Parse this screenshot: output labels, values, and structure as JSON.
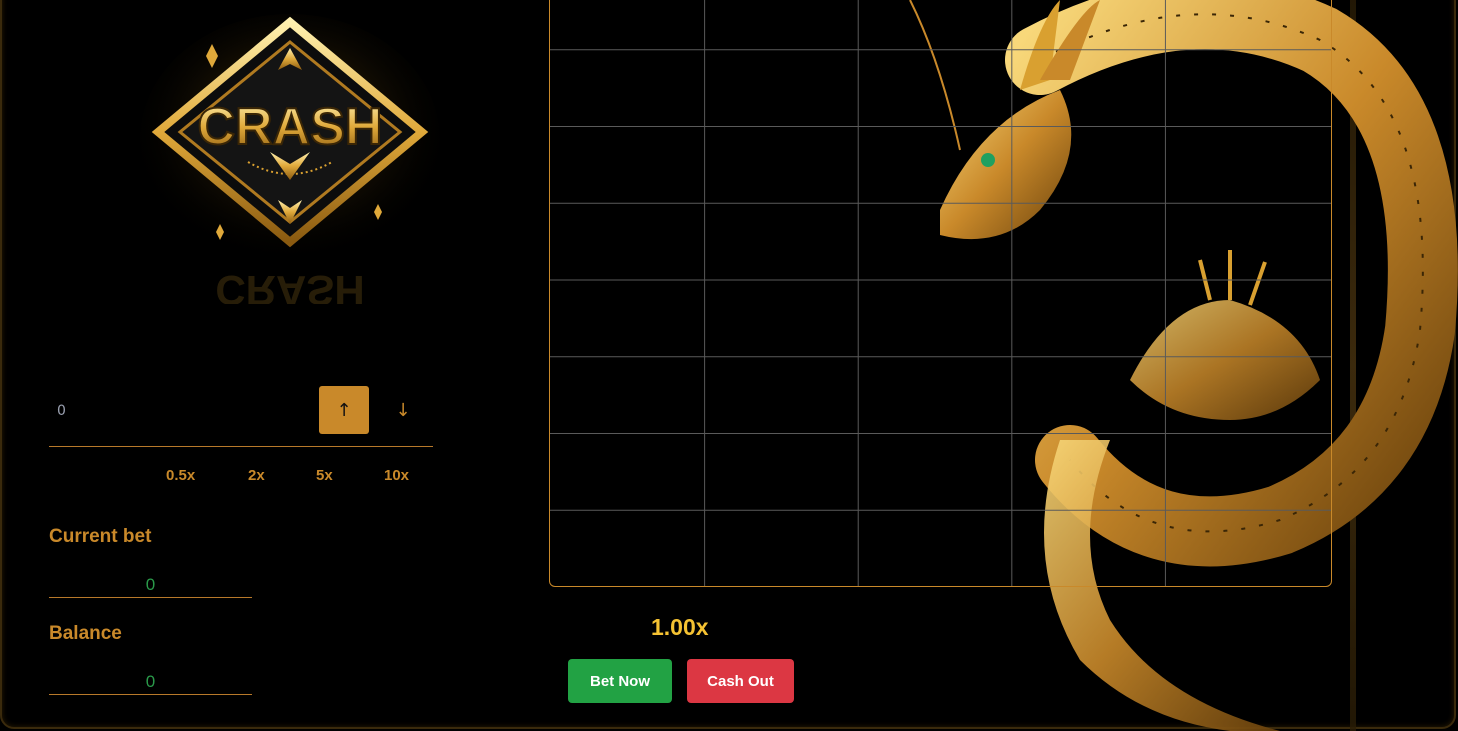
{
  "logo": {
    "text": "CRASH"
  },
  "bet": {
    "value": "0",
    "up_label": "↑",
    "down_label": "↓",
    "multipliers": [
      "0.5x",
      "2x",
      "5x",
      "10x"
    ]
  },
  "current_bet": {
    "label": "Current bet",
    "value": "0"
  },
  "balance": {
    "label": "Balance",
    "value": "0"
  },
  "game": {
    "multiplier": "1.00x",
    "bet_now_label": "Bet Now",
    "cash_out_label": "Cash Out"
  },
  "colors": {
    "accent": "#c9892a",
    "multiplier": "#f5c232",
    "bet_now": "#22a244",
    "cash_out": "#dc3743",
    "value_green": "#2a9a4a"
  }
}
